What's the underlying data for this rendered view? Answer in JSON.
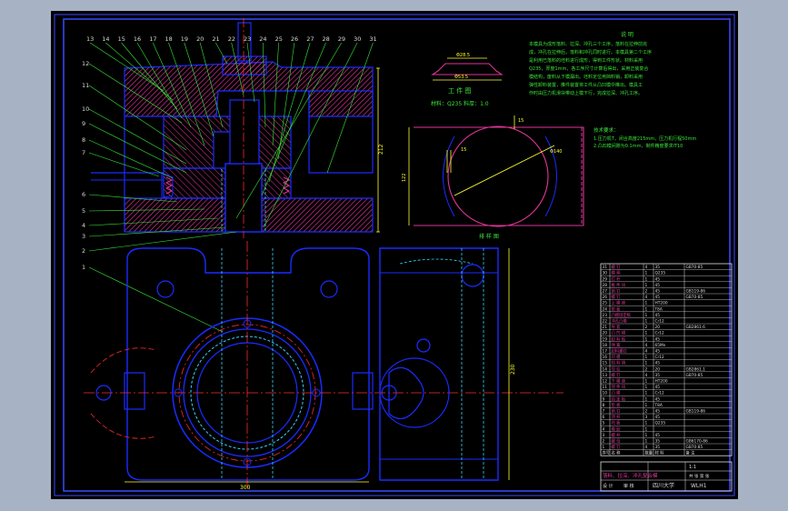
{
  "colors": {
    "backdrop": "#a7b3c4",
    "paper": "#000000",
    "frame": "#3a4cff",
    "part": "#1a2cff",
    "hatch": "#e0359a",
    "centerline": "#ff2a2a",
    "hidden": "#37d1ff",
    "leader": "#39e639",
    "text": "#39e639",
    "dimension": "#ffff33",
    "title_text": "#dcdcdc"
  },
  "balloons": {
    "top": [
      "13",
      "14",
      "15",
      "16",
      "17",
      "18",
      "19",
      "20",
      "21",
      "22",
      "23",
      "24",
      "25",
      "26",
      "27",
      "28",
      "29",
      "30",
      "31"
    ],
    "left": [
      "12",
      "11",
      "10",
      "9",
      "8",
      "7",
      "6",
      "5",
      "4",
      "3",
      "2",
      "1"
    ]
  },
  "dimensions": {
    "height_right": "212",
    "width_bottom": "300",
    "side_height": "230",
    "blank_height": "122",
    "blank_angle": "15",
    "blank_inner": "15",
    "blank_dia": "Φ140"
  },
  "notes": {
    "heading": "说  明",
    "lines": [
      "  本模具为成形落料、拉深、冲孔三个工序，落料在拉伸前完",
      "成，冲孔在拉伸后，落料和冲孔同时进行。本模具第二个工序",
      "是利用已落料的坯料进行成形，得到工件形状。材料采用",
      "Q235，厚度1mm，各工序尺寸计算后得出，采用正装复合",
      "模结构，废料从下模漏出。坯料定位用挡料销，卸料采用",
      "弹性卸料装置，推件装置将工件从凸凹模中推出。模具工",
      "作时由压力机滑块带动上模下行，完成拉深、冲孔工序。"
    ]
  },
  "workpiece": {
    "title": "工 件 图",
    "material": "材料：Q235 料厚：1.0",
    "dim_top": "Φ28.5",
    "dim_bottom": "Φ53.5"
  },
  "blank": {
    "label": "排 样 图"
  },
  "tech": {
    "title": "技术要求：",
    "line1": "1.压力机T，闭合高度215mm，压力机行程50mm",
    "line2": "2.凸凹模间隙为0.1mm，制件精度要求IT10"
  },
  "bom": {
    "rows": [
      {
        "no": "31",
        "name": "螺 钉",
        "qty": "4",
        "mat": "35",
        "note": "GB70-85"
      },
      {
        "no": "30",
        "name": "模 柄",
        "qty": "1",
        "mat": "Q235",
        "note": ""
      },
      {
        "no": "29",
        "name": "打 杆",
        "qty": "1",
        "mat": "45",
        "note": ""
      },
      {
        "no": "28",
        "name": "推 件 块",
        "qty": "1",
        "mat": "45",
        "note": ""
      },
      {
        "no": "27",
        "name": "销 钉",
        "qty": "2",
        "mat": "45",
        "note": "GB119-86"
      },
      {
        "no": "26",
        "name": "螺 钉",
        "qty": "4",
        "mat": "45",
        "note": "GB70-85"
      },
      {
        "no": "25",
        "name": "上 模 座",
        "qty": "1",
        "mat": "HT200",
        "note": ""
      },
      {
        "no": "24",
        "name": "垫 板",
        "qty": "1",
        "mat": "T8A",
        "note": ""
      },
      {
        "no": "23",
        "name": "凸模固定板",
        "qty": "1",
        "mat": "45",
        "note": ""
      },
      {
        "no": "22",
        "name": "冲孔凸模",
        "qty": "1",
        "mat": "Cr12",
        "note": ""
      },
      {
        "no": "21",
        "name": "导 套",
        "qty": "2",
        "mat": "20",
        "note": "GB2861.6"
      },
      {
        "no": "20",
        "name": "凸 凹 模",
        "qty": "1",
        "mat": "Cr12",
        "note": ""
      },
      {
        "no": "19",
        "name": "卸 料 板",
        "qty": "1",
        "mat": "45",
        "note": ""
      },
      {
        "no": "18",
        "name": "弹 簧",
        "qty": "4",
        "mat": "65Mn",
        "note": ""
      },
      {
        "no": "17",
        "name": "卸料螺钉",
        "qty": "4",
        "mat": "45",
        "note": ""
      },
      {
        "no": "16",
        "name": "凹 模",
        "qty": "1",
        "mat": "Cr12",
        "note": ""
      },
      {
        "no": "15",
        "name": "挡 料 销",
        "qty": "1",
        "mat": "45",
        "note": ""
      },
      {
        "no": "14",
        "name": "导 柱",
        "qty": "2",
        "mat": "20",
        "note": "GB2861.1"
      },
      {
        "no": "13",
        "name": "螺 钉",
        "qty": "4",
        "mat": "35",
        "note": "GB70-85"
      },
      {
        "no": "12",
        "name": "下 模 座",
        "qty": "1",
        "mat": "HT200",
        "note": ""
      },
      {
        "no": "11",
        "name": "顶 件 块",
        "qty": "1",
        "mat": "45",
        "note": ""
      },
      {
        "no": "10",
        "name": "凸 模",
        "qty": "1",
        "mat": "Cr12",
        "note": ""
      },
      {
        "no": "9",
        "name": "固 定 板",
        "qty": "1",
        "mat": "45",
        "note": ""
      },
      {
        "no": "8",
        "name": "垫 板",
        "qty": "1",
        "mat": "T8A",
        "note": ""
      },
      {
        "no": "7",
        "name": "销 钉",
        "qty": "2",
        "mat": "45",
        "note": "GB119-86"
      },
      {
        "no": "6",
        "name": "顶 杆",
        "qty": "3",
        "mat": "45",
        "note": ""
      },
      {
        "no": "5",
        "name": "托 板",
        "qty": "1",
        "mat": "Q235",
        "note": ""
      },
      {
        "no": "4",
        "name": "橡 胶",
        "qty": "1",
        "mat": "",
        "note": ""
      },
      {
        "no": "3",
        "name": "螺 杆",
        "qty": "1",
        "mat": "45",
        "note": ""
      },
      {
        "no": "2",
        "name": "螺 母",
        "qty": "1",
        "mat": "35",
        "note": "GB6170-86"
      },
      {
        "no": "1",
        "name": "螺 钉",
        "qty": "4",
        "mat": "35",
        "note": "GB70-85"
      }
    ],
    "header": {
      "no": "序号",
      "name": "名 称",
      "qty": "数量",
      "mat": "材 料",
      "note": "备 注"
    }
  },
  "title_block": {
    "title": "落料、拉深、冲孔复合模",
    "scale": "1:1",
    "designer": "设 计",
    "checker": "审 核",
    "school": "四川大学",
    "drawing_no": "WLH1",
    "sheet": "共 张  第 张"
  }
}
